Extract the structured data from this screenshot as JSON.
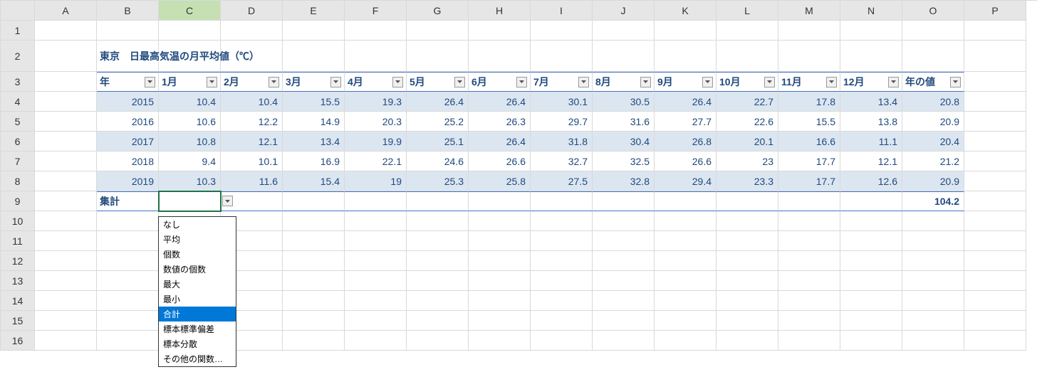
{
  "columns_letters": [
    "A",
    "B",
    "C",
    "D",
    "E",
    "F",
    "G",
    "H",
    "I",
    "J",
    "K",
    "L",
    "M",
    "N",
    "O",
    "P"
  ],
  "row_numbers": [
    1,
    2,
    3,
    4,
    5,
    6,
    7,
    8,
    9,
    10,
    11,
    12,
    13,
    14,
    15,
    16
  ],
  "title": "東京　日最高気温の月平均値（℃）",
  "headers": [
    "年",
    "1月",
    "2月",
    "3月",
    "4月",
    "5月",
    "6月",
    "7月",
    "8月",
    "9月",
    "10月",
    "11月",
    "12月",
    "年の値"
  ],
  "rows": [
    {
      "year": "2015",
      "v": [
        "10.4",
        "10.4",
        "15.5",
        "19.3",
        "26.4",
        "26.4",
        "30.1",
        "30.5",
        "26.4",
        "22.7",
        "17.8",
        "13.4",
        "20.8"
      ]
    },
    {
      "year": "2016",
      "v": [
        "10.6",
        "12.2",
        "14.9",
        "20.3",
        "25.2",
        "26.3",
        "29.7",
        "31.6",
        "27.7",
        "22.6",
        "15.5",
        "13.8",
        "20.9"
      ]
    },
    {
      "year": "2017",
      "v": [
        "10.8",
        "12.1",
        "13.4",
        "19.9",
        "25.1",
        "26.4",
        "31.8",
        "30.4",
        "26.8",
        "20.1",
        "16.6",
        "11.1",
        "20.4"
      ]
    },
    {
      "year": "2018",
      "v": [
        "9.4",
        "10.1",
        "16.9",
        "22.1",
        "24.6",
        "26.6",
        "32.7",
        "32.5",
        "26.6",
        "23",
        "17.7",
        "12.1",
        "21.2"
      ]
    },
    {
      "year": "2019",
      "v": [
        "10.3",
        "11.6",
        "15.4",
        "19",
        "25.3",
        "25.8",
        "27.5",
        "32.8",
        "29.4",
        "23.3",
        "17.7",
        "12.6",
        "20.9"
      ]
    }
  ],
  "total_label": "集計",
  "total_value": "104.2",
  "dropdown": {
    "items": [
      "なし",
      "平均",
      "個数",
      "数値の個数",
      "最大",
      "最小",
      "合計",
      "標本標準偏差",
      "標本分散",
      "その他の関数…"
    ],
    "selected": "合計"
  },
  "chart_data": {
    "type": "table",
    "title": "東京　日最高気温の月平均値（℃）",
    "columns": [
      "年",
      "1月",
      "2月",
      "3月",
      "4月",
      "5月",
      "6月",
      "7月",
      "8月",
      "9月",
      "10月",
      "11月",
      "12月",
      "年の値"
    ],
    "rows": [
      [
        2015,
        10.4,
        10.4,
        15.5,
        19.3,
        26.4,
        26.4,
        30.1,
        30.5,
        26.4,
        22.7,
        17.8,
        13.4,
        20.8
      ],
      [
        2016,
        10.6,
        12.2,
        14.9,
        20.3,
        25.2,
        26.3,
        29.7,
        31.6,
        27.7,
        22.6,
        15.5,
        13.8,
        20.9
      ],
      [
        2017,
        10.8,
        12.1,
        13.4,
        19.9,
        25.1,
        26.4,
        31.8,
        30.4,
        26.8,
        20.1,
        16.6,
        11.1,
        20.4
      ],
      [
        2018,
        9.4,
        10.1,
        16.9,
        22.1,
        24.6,
        26.6,
        32.7,
        32.5,
        26.6,
        23,
        17.7,
        12.1,
        21.2
      ],
      [
        2019,
        10.3,
        11.6,
        15.4,
        19,
        25.3,
        25.8,
        27.5,
        32.8,
        29.4,
        23.3,
        17.7,
        12.6,
        20.9
      ]
    ],
    "total_year_value": 104.2
  }
}
